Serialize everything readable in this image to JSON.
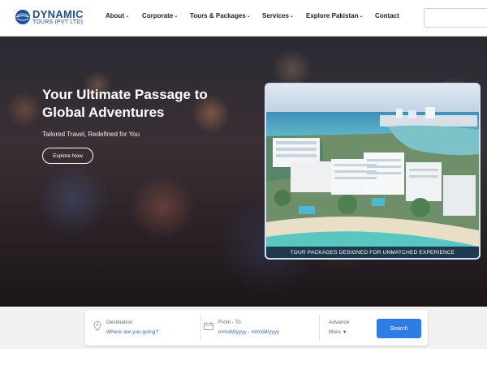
{
  "brand": {
    "name": "DYNAMIC",
    "tagline": "TOURS (PVT LTD)"
  },
  "nav": {
    "items": [
      {
        "label": "About",
        "has_dropdown": true
      },
      {
        "label": "Corporate",
        "has_dropdown": true
      },
      {
        "label": "Tours & Packages",
        "has_dropdown": true
      },
      {
        "label": "Services",
        "has_dropdown": true
      },
      {
        "label": "Explore Pakistan",
        "has_dropdown": true
      },
      {
        "label": "Contact",
        "has_dropdown": false
      }
    ]
  },
  "hero": {
    "title": "Your Ultimate Passage to Global Adventures",
    "subtitle": "Tailored Travel, Redefined for You",
    "cta": "Explore Now",
    "photo_caption": "TOUR PACKAGES DESIGNED FOR UNMATCHED EXPERIENCE"
  },
  "search": {
    "destination_label": "Destination",
    "destination_placeholder": "Where are you going?",
    "dates_label": "From - To",
    "dates_placeholder": "mm/dd/yyyy - mm/dd/yyyy",
    "advance_label": "Advance",
    "advance_value": "More",
    "button_label": "Search"
  },
  "colors": {
    "brand_blue": "#1e4f95",
    "accent_blue": "#2f7de4",
    "link_blue": "#3a67b4"
  }
}
